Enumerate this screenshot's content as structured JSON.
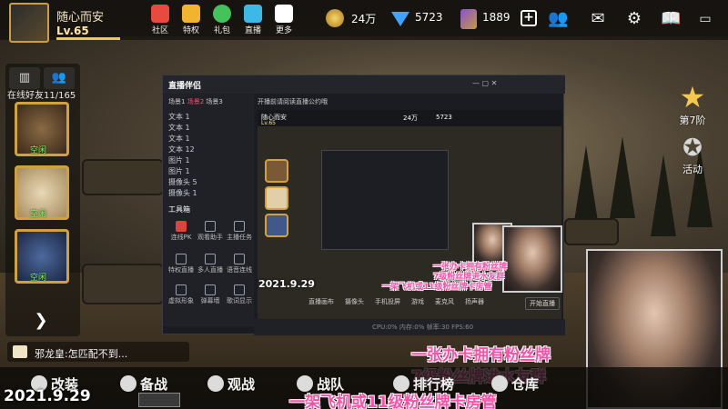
{
  "player": {
    "nickname": "随心而安",
    "level": "Lv.65"
  },
  "nav": [
    {
      "label": "社区",
      "icon": "home-icon"
    },
    {
      "label": "特权",
      "icon": "crown-icon"
    },
    {
      "label": "礼包",
      "icon": "gift-chat-icon"
    },
    {
      "label": "直播",
      "icon": "play-icon"
    },
    {
      "label": "更多",
      "icon": "grid-icon"
    }
  ],
  "resources": {
    "gold": "24万",
    "diamonds": "5723",
    "tickets": "1889"
  },
  "left_panel": {
    "online_friends": "在线好友11/165",
    "friend_status": "空闲"
  },
  "right_panel": {
    "rank_label": "第7阶",
    "event_label": "活动"
  },
  "broadcast": {
    "app_name": "直播伴侣",
    "scenes": [
      "场景1",
      "场景2",
      "场景3"
    ],
    "layers": [
      "文本 1",
      "文本 1",
      "文本 1",
      "文本 12",
      "图片 1",
      "图片 1",
      "摄像头 5",
      "摄像头 1"
    ],
    "toolbox_label": "工具箱",
    "tools": [
      "连线PK",
      "观看助手",
      "主播任务",
      "特权直播",
      "多人直播",
      "语音连线",
      "虚拟形象",
      "弹幕墙",
      "歌词显示"
    ],
    "notice": "开播前请阅读直播公约哦",
    "preview_nick": "随心而安",
    "preview_level": "Lv.65",
    "preview_gold": "24万",
    "preview_diamonds": "5723",
    "bottom_tools": [
      "直播画布",
      "摄像头",
      "手机投屏",
      "游戏",
      "麦克风",
      "扬声器"
    ],
    "go_live": "开始直播",
    "stats": "CPU:0%  内存:0%  帧率:30  FPS:60"
  },
  "overlay": {
    "date": "2021.9.29",
    "line1": "一张办卡拥有粉丝牌",
    "line2": "7级粉丝牌进水友群",
    "line3": "一架飞机或11级粉丝牌卡房管"
  },
  "chat": {
    "message": "邪龙皇:怎匹配不到..."
  },
  "bottom_nav": [
    "改装",
    "备战",
    "观战",
    "战队",
    "排行榜",
    "仓库"
  ]
}
